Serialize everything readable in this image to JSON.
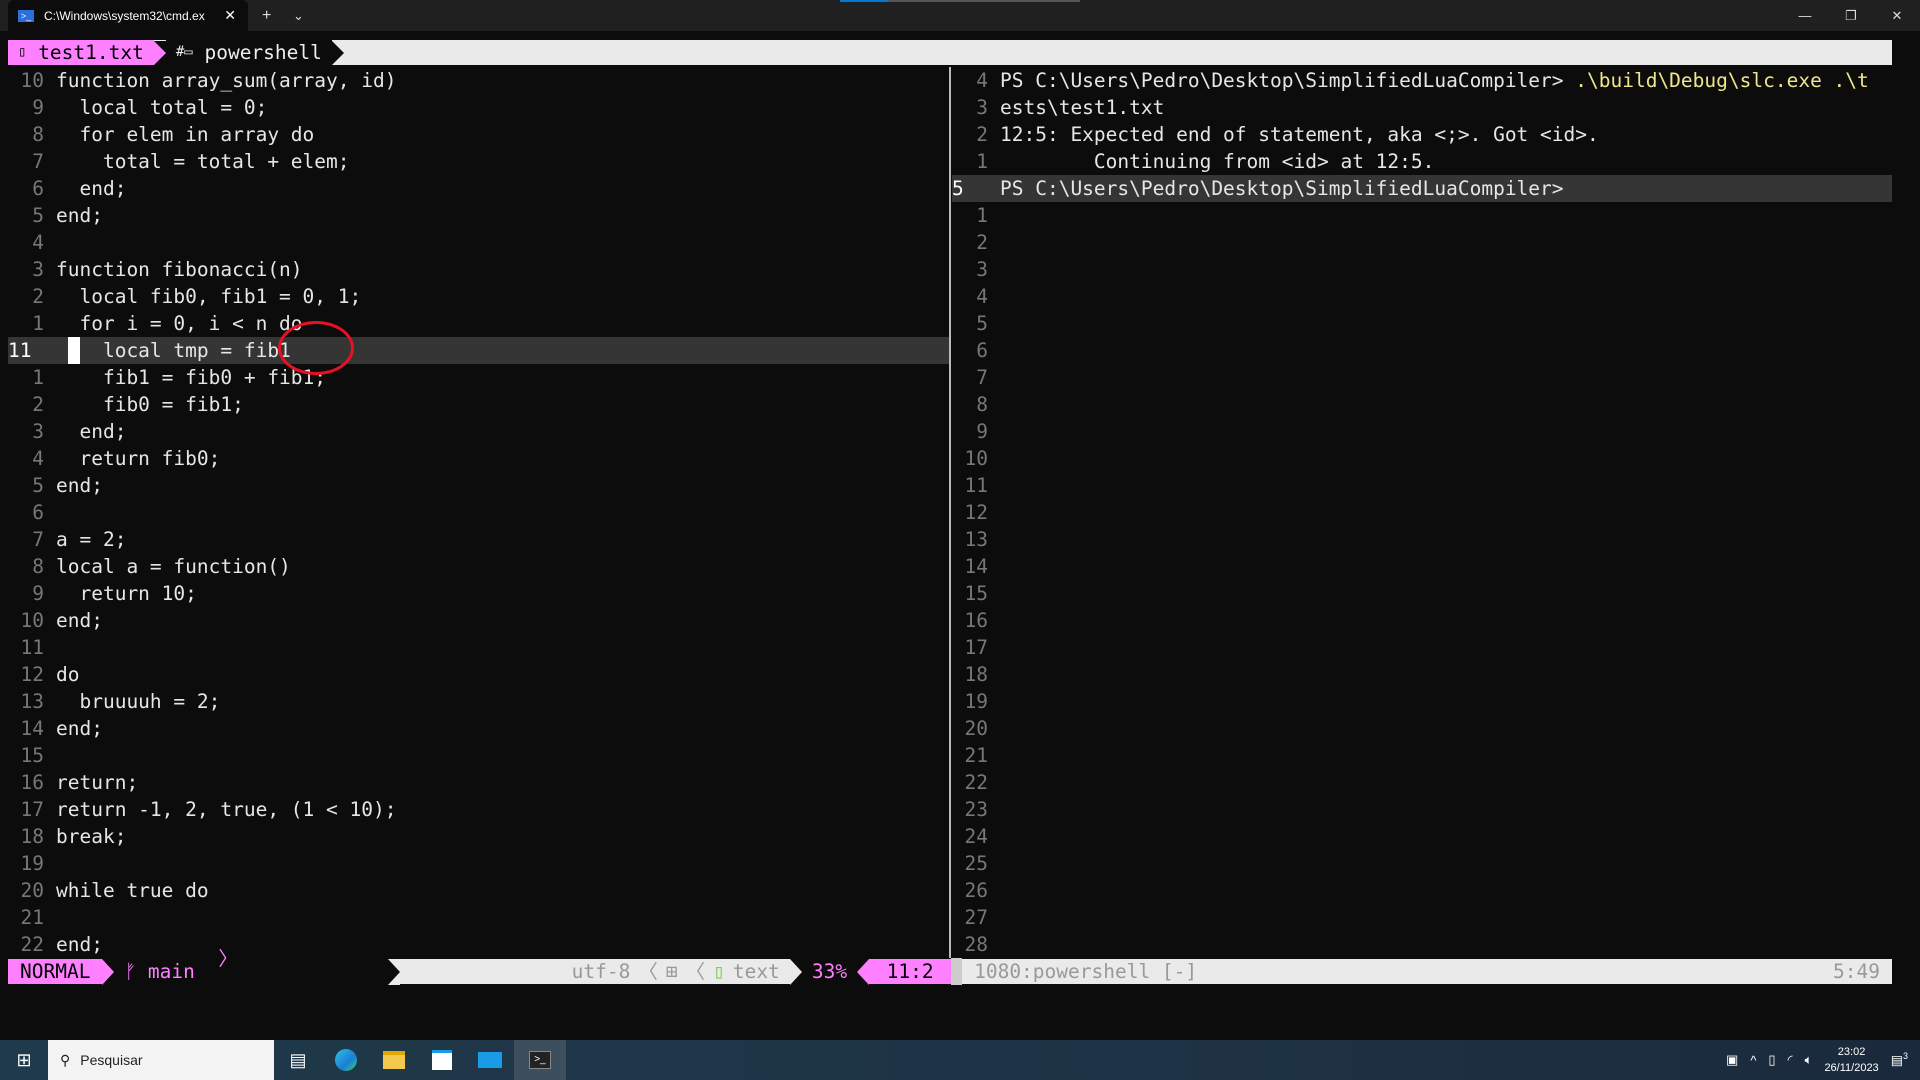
{
  "window": {
    "tab_title": "C:\\Windows\\system32\\cmd.ex",
    "new_tab": "+",
    "dropdown": "⌄",
    "minimize": "—",
    "maximize": "❐",
    "close": "✕",
    "tab_close": "✕"
  },
  "tabline": {
    "file_icon": "▯",
    "file": "test1.txt",
    "term_icon": "#▭",
    "term": "powershell"
  },
  "editor": {
    "lines": [
      {
        "n": "10",
        "t": "function array_sum(array, id)"
      },
      {
        "n": "9",
        "t": "  local total = 0;"
      },
      {
        "n": "8",
        "t": "  for elem in array do"
      },
      {
        "n": "7",
        "t": "    total = total + elem;"
      },
      {
        "n": "6",
        "t": "  end;"
      },
      {
        "n": "5",
        "t": "end;"
      },
      {
        "n": "4",
        "t": ""
      },
      {
        "n": "3",
        "t": "function fibonacci(n)"
      },
      {
        "n": "2",
        "t": "  local fib0, fib1 = 0, 1;"
      },
      {
        "n": "1",
        "t": "  for i = 0, i < n do"
      },
      {
        "n": "11",
        "t": "    local tmp = fib1",
        "current": true
      },
      {
        "n": "1",
        "t": "    fib1 = fib0 + fib1;"
      },
      {
        "n": "2",
        "t": "    fib0 = fib1;"
      },
      {
        "n": "3",
        "t": "  end;"
      },
      {
        "n": "4",
        "t": "  return fib0;"
      },
      {
        "n": "5",
        "t": "end;"
      },
      {
        "n": "6",
        "t": ""
      },
      {
        "n": "7",
        "t": "a = 2;"
      },
      {
        "n": "8",
        "t": "local a = function()"
      },
      {
        "n": "9",
        "t": "  return 10;"
      },
      {
        "n": "10",
        "t": "end;"
      },
      {
        "n": "11",
        "t": ""
      },
      {
        "n": "12",
        "t": "do"
      },
      {
        "n": "13",
        "t": "  bruuuuh = 2;"
      },
      {
        "n": "14",
        "t": "end;"
      },
      {
        "n": "15",
        "t": ""
      },
      {
        "n": "16",
        "t": "return;"
      },
      {
        "n": "17",
        "t": "return -1, 2, true, (1 < 10);"
      },
      {
        "n": "18",
        "t": "break;"
      },
      {
        "n": "19",
        "t": ""
      },
      {
        "n": "20",
        "t": "while true do"
      },
      {
        "n": "21",
        "t": ""
      },
      {
        "n": "22",
        "t": "end;"
      }
    ]
  },
  "terminal": {
    "lines": [
      {
        "n": "4",
        "t": "PS C:\\Users\\Pedro\\Desktop\\SimplifiedLuaCompiler> ",
        "hl": ".\\build\\Debug\\slc.exe .\\t"
      },
      {
        "n": "3",
        "t": "ests\\test1.txt"
      },
      {
        "n": "2",
        "t": "12:5: Expected end of statement, aka <;>. Got <id>."
      },
      {
        "n": "1",
        "t": "        Continuing from <id> at 12:5."
      },
      {
        "n": "5",
        "t": "PS C:\\Users\\Pedro\\Desktop\\SimplifiedLuaCompiler>",
        "current": true
      },
      {
        "n": "1",
        "t": ""
      },
      {
        "n": "2",
        "t": ""
      },
      {
        "n": "3",
        "t": ""
      },
      {
        "n": "4",
        "t": ""
      },
      {
        "n": "5",
        "t": ""
      },
      {
        "n": "6",
        "t": ""
      },
      {
        "n": "7",
        "t": ""
      },
      {
        "n": "8",
        "t": ""
      },
      {
        "n": "9",
        "t": ""
      },
      {
        "n": "10",
        "t": ""
      },
      {
        "n": "11",
        "t": ""
      },
      {
        "n": "12",
        "t": ""
      },
      {
        "n": "13",
        "t": ""
      },
      {
        "n": "14",
        "t": ""
      },
      {
        "n": "15",
        "t": ""
      },
      {
        "n": "16",
        "t": ""
      },
      {
        "n": "17",
        "t": ""
      },
      {
        "n": "18",
        "t": ""
      },
      {
        "n": "19",
        "t": ""
      },
      {
        "n": "20",
        "t": ""
      },
      {
        "n": "21",
        "t": ""
      },
      {
        "n": "22",
        "t": ""
      },
      {
        "n": "23",
        "t": ""
      },
      {
        "n": "24",
        "t": ""
      },
      {
        "n": "25",
        "t": ""
      },
      {
        "n": "26",
        "t": ""
      },
      {
        "n": "27",
        "t": ""
      },
      {
        "n": "28",
        "t": ""
      }
    ]
  },
  "statusline": {
    "mode": "NORMAL",
    "branch_icon": "ᚠ",
    "branch": "main",
    "encoding": "utf-8",
    "os_icon": "⊞",
    "ft_icon": "▯",
    "filetype": "text",
    "percent": "33%",
    "position": "11:2",
    "term_name": "1080:powershell [-]",
    "term_position": "5:49"
  },
  "taskbar": {
    "start_icon": "⊞",
    "search": "Pesquisar",
    "search_icon": "⚲",
    "time": "23:02",
    "date": "26/11/2023",
    "notifications": "3",
    "tray_chevron": "^"
  },
  "colors": {
    "accent": "#ff80ff",
    "highlight": "#f0e68c",
    "annotation": "#e81123"
  }
}
